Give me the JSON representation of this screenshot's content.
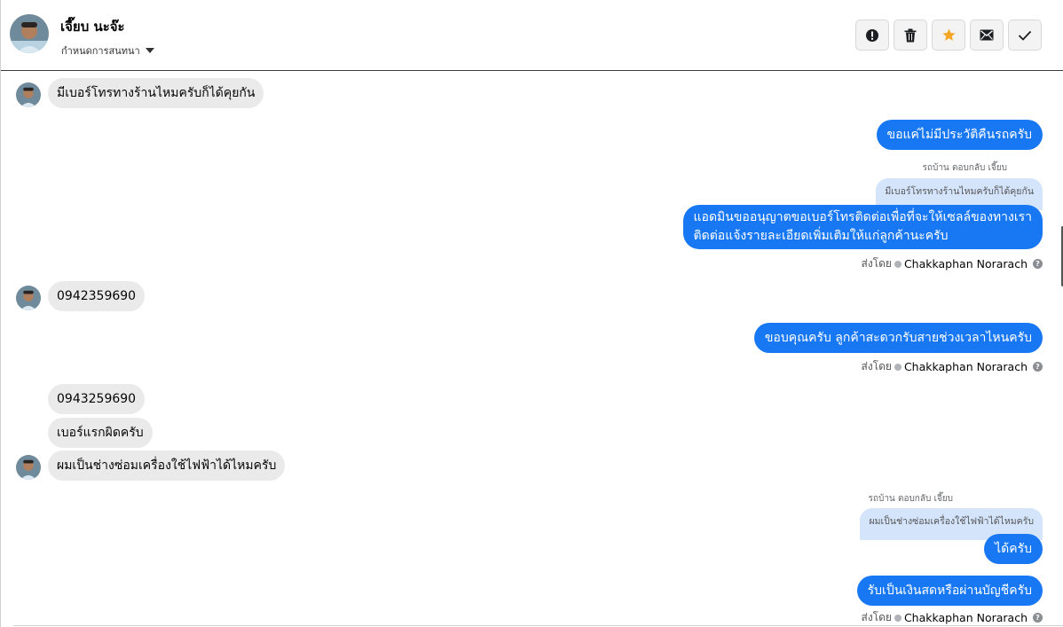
{
  "header": {
    "contact_name": "เจี๊ยบ นะจ๊ะ",
    "assign_label": "กำหนดการสนทนา",
    "actions": [
      "spam-icon",
      "trash-icon",
      "star-icon",
      "mail-icon",
      "check-icon"
    ]
  },
  "colors": {
    "outgoing": "#1877f2",
    "incoming": "#eaeaea",
    "quote": "#d4e4fb",
    "star": "#f5a623"
  },
  "messages": {
    "m1": "มีเบอร์โทรทางร้านไหมครับก็ได้คุยกัน",
    "m2": "ขอแค่ไม่มีประวัติคืนรถครับ",
    "q1_label": "รถบ้าน ตอบกลับ เจี๊ยบ",
    "q1_text": "มีเบอร์โทรทางร้านไหมครับก็ได้คุยกัน",
    "m3_line1": "แอดมินขออนุญาตขอเบอร์โทรติดต่อเพื่อที่จะให้เซลล์ของทางเรา",
    "m3_line2": "ติดต่อแจ้งรายละเอียดเพิ่มเติมให้แก่ลูกค้านะครับ",
    "sent_by_label": "ส่งโดย",
    "sent_by_name": "Chakkaphan Norarach",
    "m4": "0942359690",
    "m5": "ขอบคุณครับ ลูกค้าสะดวกรับสายช่วงเวลาไหนครับ",
    "m6": "0943259690",
    "m7": "เบอร์แรกผิดครับ",
    "m8": "ผมเป็นช่างซ่อมเครื่องใช้ไฟฟ้าได้ไหมครับ",
    "q2_label": "รถบ้าน ตอบกลับ เจี๊ยบ",
    "q2_text": "ผมเป็นช่างซ่อมเครื่องใช้ไฟฟ้าได้ไหมครับ",
    "m9": "ได้ครับ",
    "m10": "รับเป็นเงินสดหรือผ่านบัญชีครับ"
  }
}
